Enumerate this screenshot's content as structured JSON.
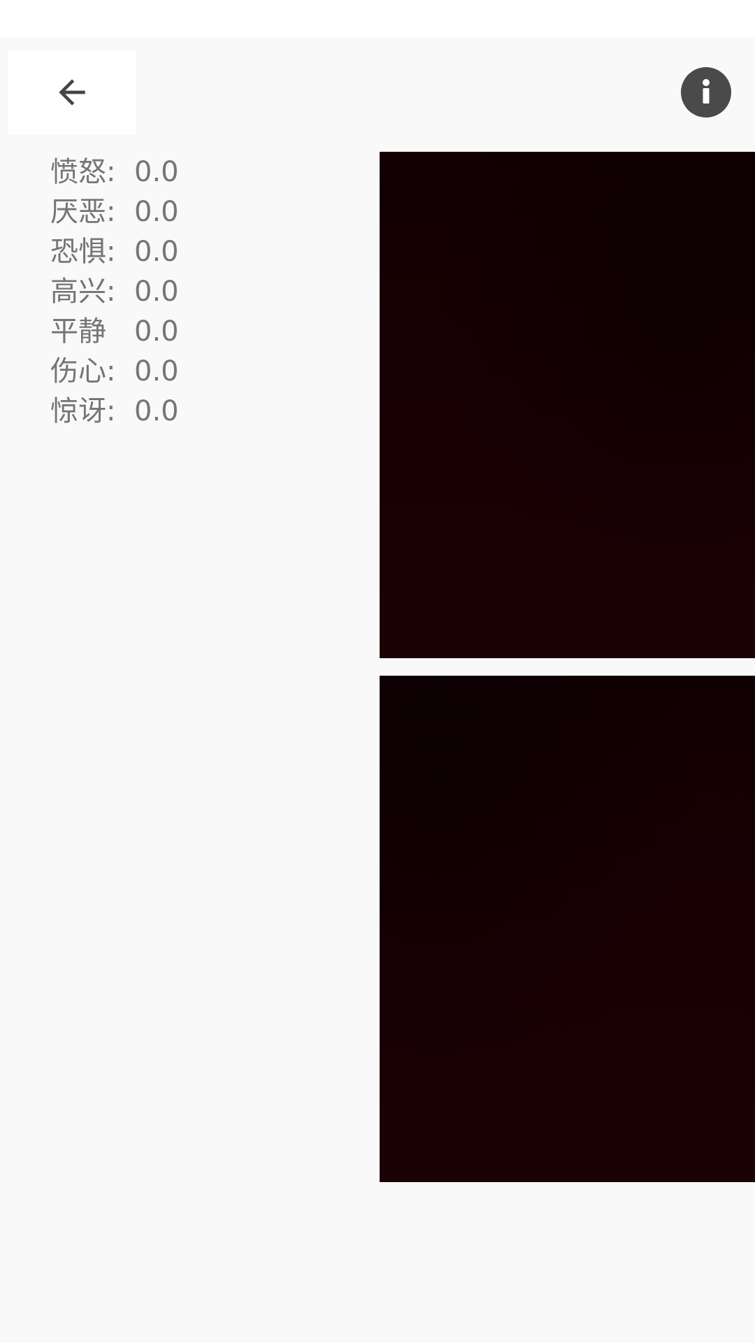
{
  "toolbar": {
    "back_icon": "arrow-left-icon",
    "info_icon": "info-icon"
  },
  "emotions": [
    {
      "label": "愤怒:",
      "value": "0.0"
    },
    {
      "label": "厌恶:",
      "value": "0.0"
    },
    {
      "label": "恐惧:",
      "value": "0.0"
    },
    {
      "label": "高兴:",
      "value": "0.0"
    },
    {
      "label": "平静",
      "value": "0.0"
    },
    {
      "label": "伤心:",
      "value": "0.0"
    },
    {
      "label": "惊讶:",
      "value": "0.0"
    }
  ],
  "colors": {
    "background": "#f9f9f9",
    "text": "#757575",
    "info_button": "#4a4a4a",
    "camera_preview": "#180003"
  }
}
